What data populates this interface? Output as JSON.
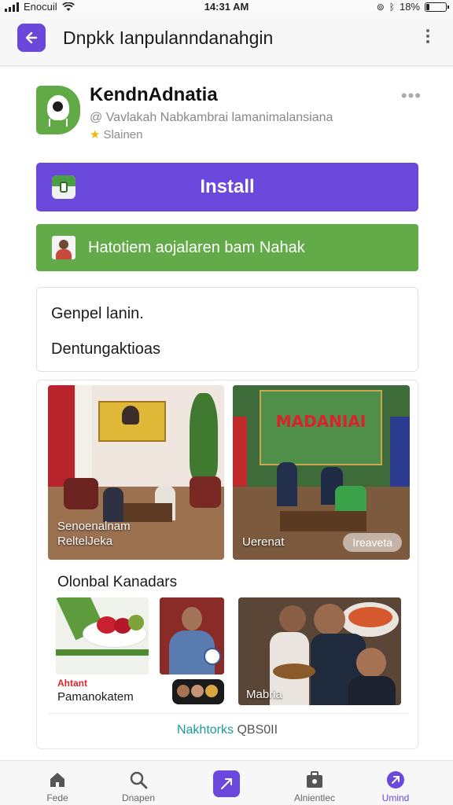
{
  "status_bar": {
    "carrier": "Enocuil",
    "time": "14:31 AM",
    "battery_text": "18%",
    "battery_level": 0.18
  },
  "app_bar": {
    "title": "Dnpkk Ianpulanndanahgin",
    "back_icon": "arrow-left-icon",
    "menu_icon": "kebab-menu-icon"
  },
  "app_info": {
    "name": "KendnAdnatia",
    "subtitle": "@ Vavlakah Nabkambrai lamanimalansiana",
    "rating_label": "Slainen",
    "more_icon": "more-horizontal-icon"
  },
  "actions": {
    "install_label": "Install",
    "promo_label": "Hatotiem aojalaren bam Nahak"
  },
  "info_box": {
    "line1": "Genpel lanin.",
    "line2": "Dentungaktioas"
  },
  "gallery": {
    "media1_caption_line1": "Senoenalnam",
    "media1_caption_line2": "ReltelJeka",
    "media2_banner": "MADANIAI",
    "media2_caption": "Uerenat",
    "media2_pill": "Ireaveta",
    "section_title": "Olonbal Kanadars",
    "food_label_red": "Ahtant",
    "food_label": "Pamanokatem",
    "thumb3_caption": "Mabria",
    "link_highlight": "Nakhtorks",
    "link_rest": " QBS0II"
  },
  "bottom_nav": [
    {
      "label": "Fede",
      "icon": "home-icon"
    },
    {
      "label": "Dnapen",
      "icon": "search-icon"
    },
    {
      "label": "",
      "icon": "compose-icon"
    },
    {
      "label": "Alnientlec",
      "icon": "briefcase-icon"
    },
    {
      "label": "Umind",
      "icon": "profile-icon",
      "active": true
    }
  ],
  "colors": {
    "accent_purple": "#6a48dc",
    "accent_green": "#63ab48",
    "link_teal": "#1d9a9a"
  }
}
